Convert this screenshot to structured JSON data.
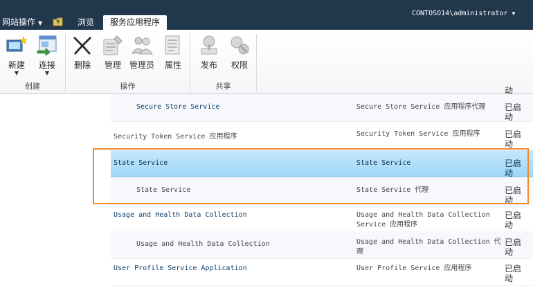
{
  "topbar": {
    "site_actions": "网站操作",
    "tabs": [
      {
        "label": "浏览"
      },
      {
        "label": "服务应用程序"
      }
    ],
    "user": "CONTOSO14\\administrator"
  },
  "ribbon": {
    "groups": [
      {
        "label": "创建",
        "buttons": [
          {
            "label": "新建"
          },
          {
            "label": "连接"
          }
        ]
      },
      {
        "label": "操作",
        "buttons": [
          {
            "label": "删除"
          },
          {
            "label": "管理"
          },
          {
            "label": "管理员"
          },
          {
            "label": "属性"
          }
        ]
      },
      {
        "label": "共享",
        "buttons": [
          {
            "label": "发布"
          },
          {
            "label": "权限"
          }
        ]
      }
    ]
  },
  "table": {
    "top_partial_status": "动",
    "rows": [
      {
        "name": "Secure Store Service",
        "type": "Secure Store Service 应用程序代理",
        "status": "已启动"
      },
      {
        "name": "Security Token Service 应用程序",
        "type": "Security Token Service 应用程序",
        "status": "已启动"
      },
      {
        "name": "State Service",
        "type": "State Service",
        "status": "已启动"
      },
      {
        "name": "State Service",
        "type": "State Service 代理",
        "status": "已启动"
      },
      {
        "name": "Usage and Health Data Collection",
        "type": "Usage and Health Data Collection Service 应用程序",
        "status": "已启动"
      },
      {
        "name": "Usage and Health Data Collection",
        "type": "Usage and Health Data Collection 代理",
        "status": "已启动"
      },
      {
        "name": "User Profile Service Application",
        "type": "User Profile Service 应用程序",
        "status": "已启动"
      }
    ]
  },
  "colors": {
    "topbar": "#21374c",
    "selected_row": "#9fd7f6",
    "highlight_border": "#f28a2c",
    "link": "#0f3f6b"
  }
}
